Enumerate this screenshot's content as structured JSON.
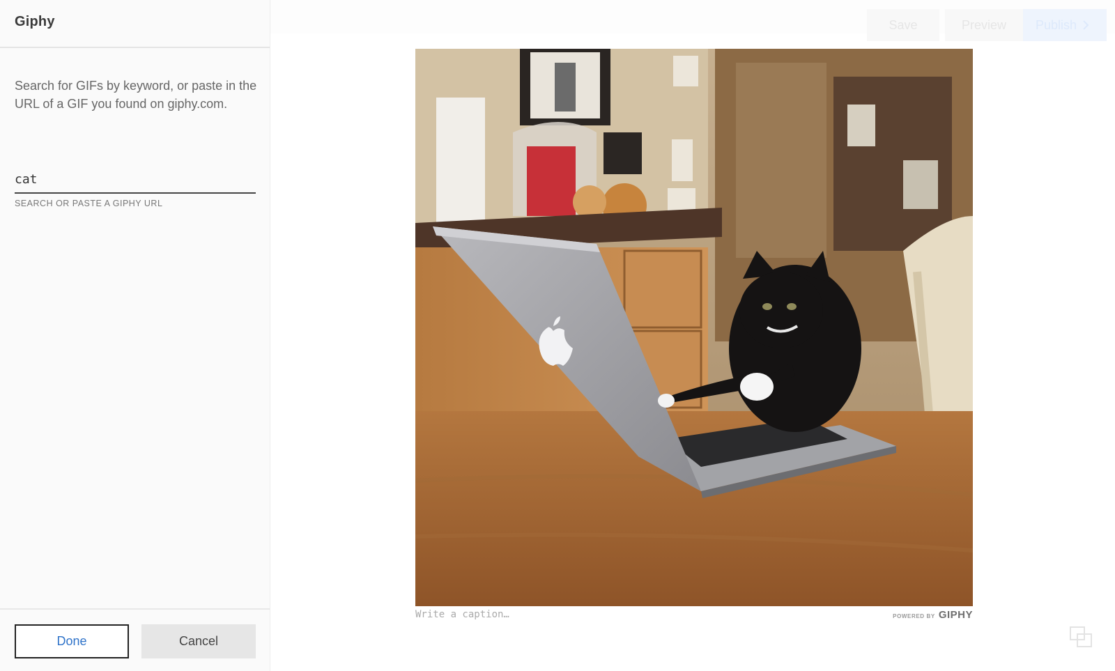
{
  "sidebar": {
    "title": "Giphy",
    "description": "Search for GIFs by keyword, or paste in the URL of a GIF you found on giphy.com.",
    "search": {
      "value": "cat",
      "hint": "SEARCH OR PASTE A GIPHY URL"
    },
    "done_label": "Done",
    "cancel_label": "Cancel"
  },
  "toolbar": {
    "save_label": "Save",
    "preview_label": "Preview",
    "publish_label": "Publish"
  },
  "gif": {
    "caption_placeholder": "Write a caption…",
    "powered_by": "POWERED BY",
    "brand": "GIPHY"
  },
  "icons": {
    "publish_chevron": "chevron-right-icon",
    "corner": "overlap-squares-icon"
  },
  "colors": {
    "accent": "#2f73c9",
    "sidebar_bg": "#fafafa"
  }
}
